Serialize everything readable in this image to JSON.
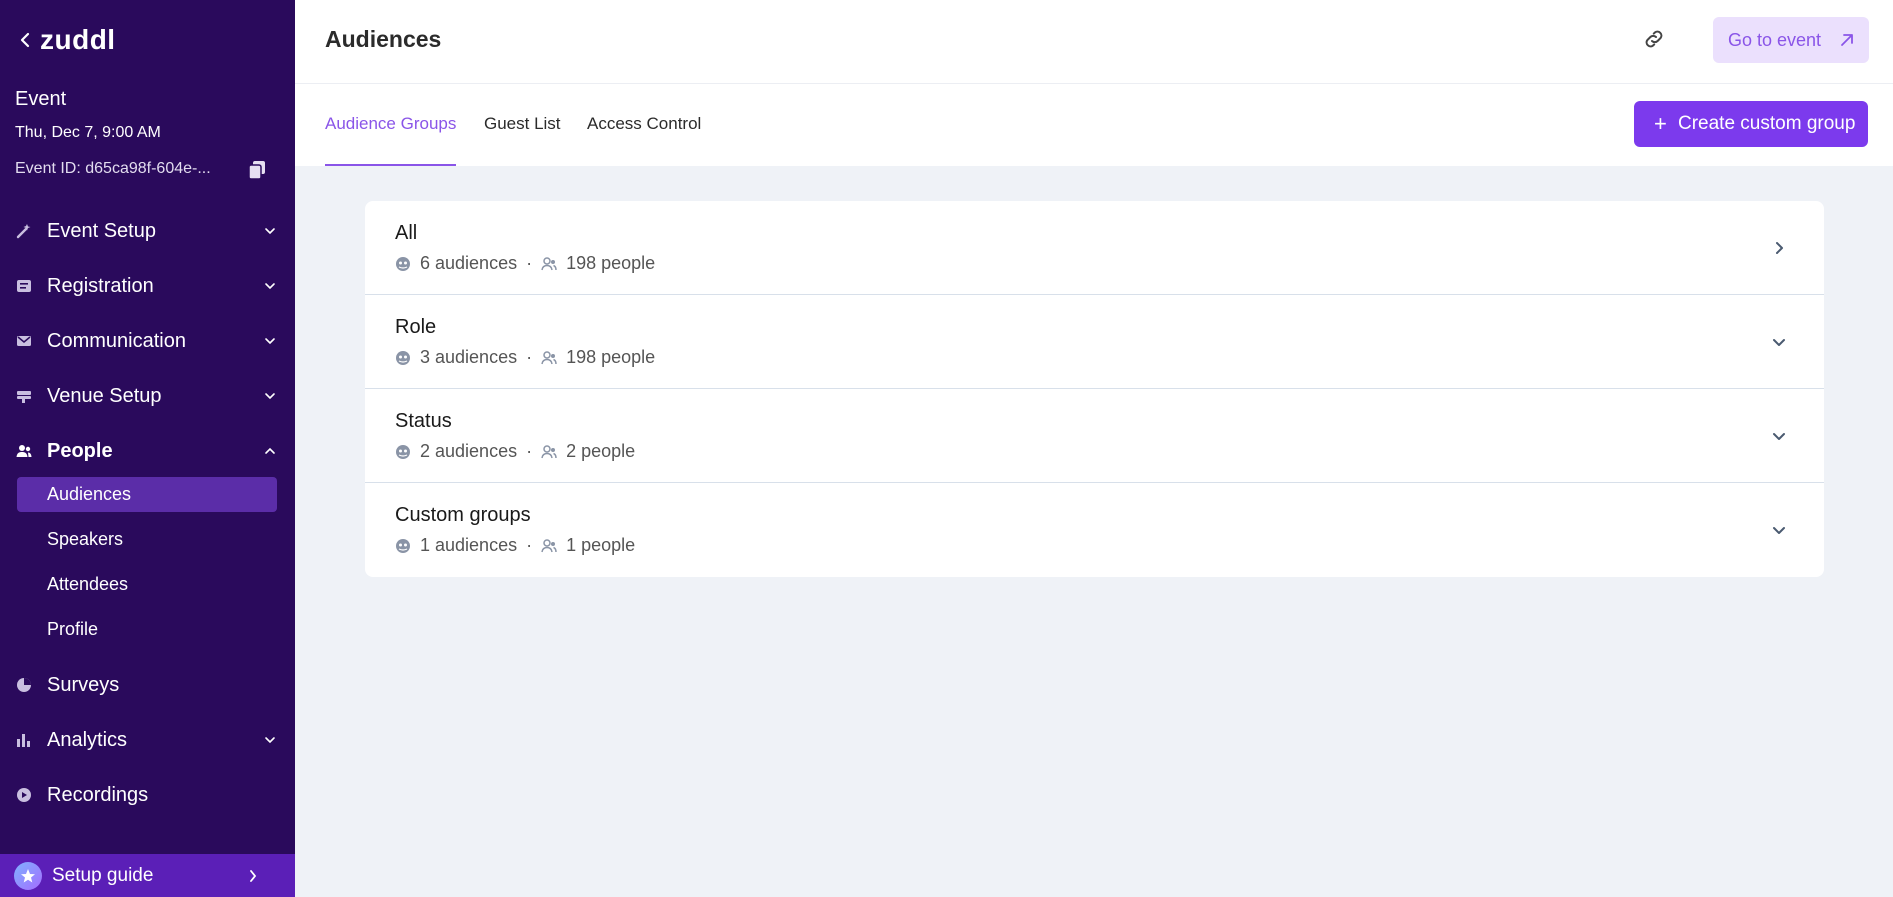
{
  "brand": {
    "logo": "zuddl"
  },
  "event": {
    "name": "Event",
    "date": "Thu, Dec 7, 9:00 AM",
    "id_label": "Event ID: d65ca98f-604e-..."
  },
  "nav": {
    "event_setup": "Event Setup",
    "registration": "Registration",
    "communication": "Communication",
    "venue_setup": "Venue Setup",
    "people": "People",
    "people_sub": {
      "audiences": "Audiences",
      "speakers": "Speakers",
      "attendees": "Attendees",
      "profile": "Profile"
    },
    "surveys": "Surveys",
    "analytics": "Analytics",
    "recordings": "Recordings"
  },
  "setup_guide": {
    "label": "Setup guide"
  },
  "header": {
    "title": "Audiences",
    "goto_label": "Go to event"
  },
  "tabs": {
    "audience_groups": "Audience Groups",
    "guest_list": "Guest List",
    "access_control": "Access Control"
  },
  "create_button": {
    "plus": "+",
    "label": "Create custom group"
  },
  "groups": [
    {
      "name": "All",
      "audiences": "6 audiences",
      "people": "198 people",
      "expand": "chevron-right"
    },
    {
      "name": "Role",
      "audiences": "3 audiences",
      "people": "198 people",
      "expand": "chevron-down"
    },
    {
      "name": "Status",
      "audiences": "2 audiences",
      "people": "2 people",
      "expand": "chevron-down"
    },
    {
      "name": "Custom groups",
      "audiences": "1 audiences",
      "people": "1 people",
      "expand": "chevron-down"
    }
  ],
  "separator": "·",
  "colors": {
    "sidebar_bg": "#2a0a5c",
    "sidebar_selected": "#5b2da8",
    "accent": "#7c3aed",
    "accent_light": "#ebe0fd",
    "page_bg": "#eff2f7"
  }
}
